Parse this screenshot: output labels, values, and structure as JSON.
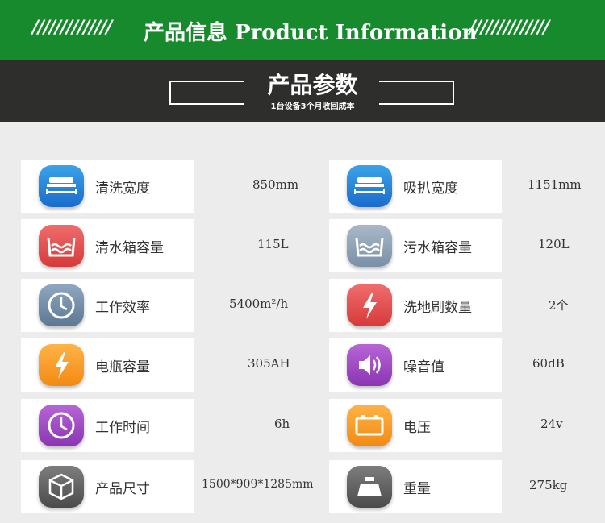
{
  "header": {
    "slashes_left": "//////////////",
    "title": "产品信息  Product Information",
    "slashes_right": "//////////////"
  },
  "banner": {
    "title": "产品参数",
    "subtitle": "1台设备3个月收回成本"
  },
  "colors": {
    "green": "#168a2c",
    "dark": "#2e2e2c",
    "background": "#ececec"
  },
  "params": [
    {
      "label": "清洗宽度",
      "value": "850mm",
      "icon": "brush-deck-icon",
      "color": "blue"
    },
    {
      "label": "吸扒宽度",
      "value": "1151mm",
      "icon": "squeegee-icon",
      "color": "blue"
    },
    {
      "label": "清水箱容量",
      "value": "115L",
      "icon": "water-tank-icon",
      "color": "red"
    },
    {
      "label": "污水箱容量",
      "value": "120L",
      "icon": "waste-tank-icon",
      "color": "steel"
    },
    {
      "label": "工作效率",
      "value": "5400m²/h",
      "icon": "clock-icon",
      "color": "steel"
    },
    {
      "label": "洗地刷数量",
      "value": "2个",
      "icon": "lightning-icon",
      "color": "red"
    },
    {
      "label": "电瓶容量",
      "value": "305AH",
      "icon": "lightning-icon",
      "color": "orange"
    },
    {
      "label": "噪音值",
      "value": "60dB",
      "icon": "speaker-icon",
      "color": "purple"
    },
    {
      "label": "工作时间",
      "value": "6h",
      "icon": "clock-icon",
      "color": "purple"
    },
    {
      "label": "电压",
      "value": "24v",
      "icon": "battery-icon",
      "color": "orange"
    },
    {
      "label": "产品尺寸",
      "value": "1500*909*1285mm",
      "icon": "box-icon",
      "color": "gray"
    },
    {
      "label": "重量",
      "value": "275kg",
      "icon": "weight-icon",
      "color": "gray"
    }
  ]
}
